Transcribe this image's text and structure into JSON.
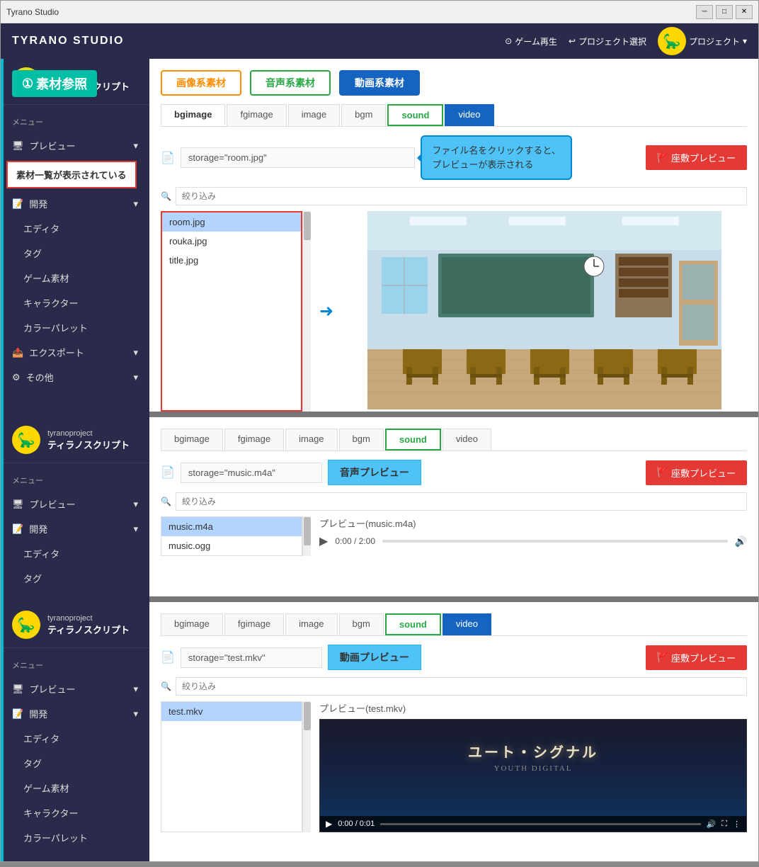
{
  "window": {
    "title": "Tyrano Studio",
    "min_btn": "─",
    "max_btn": "□",
    "close_btn": "✕"
  },
  "header": {
    "logo": "TYRANO STUDIO",
    "game_play": "ゲーム再生",
    "project_select": "プロジェクト選択",
    "project": "プロジェクト"
  },
  "sidebar": {
    "username": "tyranoproject",
    "display_name": "ティラノスクリプト",
    "section_menu": "メニュー",
    "items": [
      {
        "label": "プレビュー",
        "has_arrow": true
      },
      {
        "label": "開発",
        "has_arrow": true
      },
      {
        "label": "エディタ"
      },
      {
        "label": "タグ"
      },
      {
        "label": "ゲーム素材"
      },
      {
        "label": "キャラクター"
      },
      {
        "label": "カラーパレット"
      },
      {
        "label": "エクスポート",
        "has_arrow": true
      },
      {
        "label": "その他",
        "has_arrow": true
      }
    ]
  },
  "annotation": {
    "step": "①",
    "title": "素材参照"
  },
  "panel1": {
    "tab_groups": [
      {
        "label": "画像系素材",
        "type": "orange"
      },
      {
        "label": "音声系素材",
        "type": "green"
      },
      {
        "label": "動画系素材",
        "type": "blue"
      }
    ],
    "sub_tabs": [
      "bgimage",
      "fgimage",
      "image",
      "bgm",
      "sound",
      "video"
    ],
    "active_sub_tab": "bgimage",
    "storage_value": "storage=\"room.jpg\"",
    "storage_placeholder": "",
    "preview_btn": "座敷プレビュー",
    "filter_placeholder": "絞り込み",
    "files": [
      "room.jpg",
      "rouka.jpg",
      "title.jpg"
    ],
    "selected_file": "room.jpg",
    "tooltip_line1": "ファイル名をクリックすると、",
    "tooltip_line2": "プレビューが表示される",
    "red_annotation": "素材一覧が表示されている"
  },
  "panel2": {
    "sub_tabs": [
      "bgimage",
      "fgimage",
      "image",
      "bgm",
      "sound",
      "video"
    ],
    "active_sub_tab": "sound",
    "storage_value": "storage=\"music.m4a\"",
    "preview_label": "音声プレビュー",
    "preview_btn": "座敷プレビュー",
    "filter_placeholder": "絞り込み",
    "files": [
      "music.m4a",
      "music.ogg"
    ],
    "selected_file": "music.m4a",
    "audio_preview_label": "プレビュー(music.m4a)",
    "play_symbol": "▶",
    "time": "0:00 / 2:00",
    "volume_icon": "🔊"
  },
  "panel3": {
    "sub_tabs": [
      "bgimage",
      "fgimage",
      "image",
      "bgm",
      "sound",
      "video"
    ],
    "active_sub_tab": "video",
    "storage_value": "storage=\"test.mkv\"",
    "preview_label": "動画プレビュー",
    "preview_btn": "座敷プレビュー",
    "filter_placeholder": "絞り込み",
    "files": [
      "test.mkv"
    ],
    "selected_file": "test.mkv",
    "video_preview_label": "プレビュー(test.mkv)",
    "video_title": "ユート・シグナル",
    "video_subtitle": "YOUTH DIGITAL",
    "play_symbol": "▶",
    "time": "0:00 / 0:01",
    "vol_icon": "🔊",
    "fullscreen_icon": "⛶",
    "more_icon": "⋮"
  },
  "sidebar2": {
    "section_menu": "メニュー",
    "items_preview": "プレビュー",
    "items_dev": "開発",
    "items": [
      "エディタ",
      "タグ"
    ]
  },
  "sidebar3": {
    "section_menu": "メニュー",
    "items_preview": "プレビュー",
    "items_dev": "開発",
    "items": [
      "エディタ",
      "タグ",
      "ゲーム素材",
      "キャラクター",
      "カラーパレット"
    ]
  }
}
